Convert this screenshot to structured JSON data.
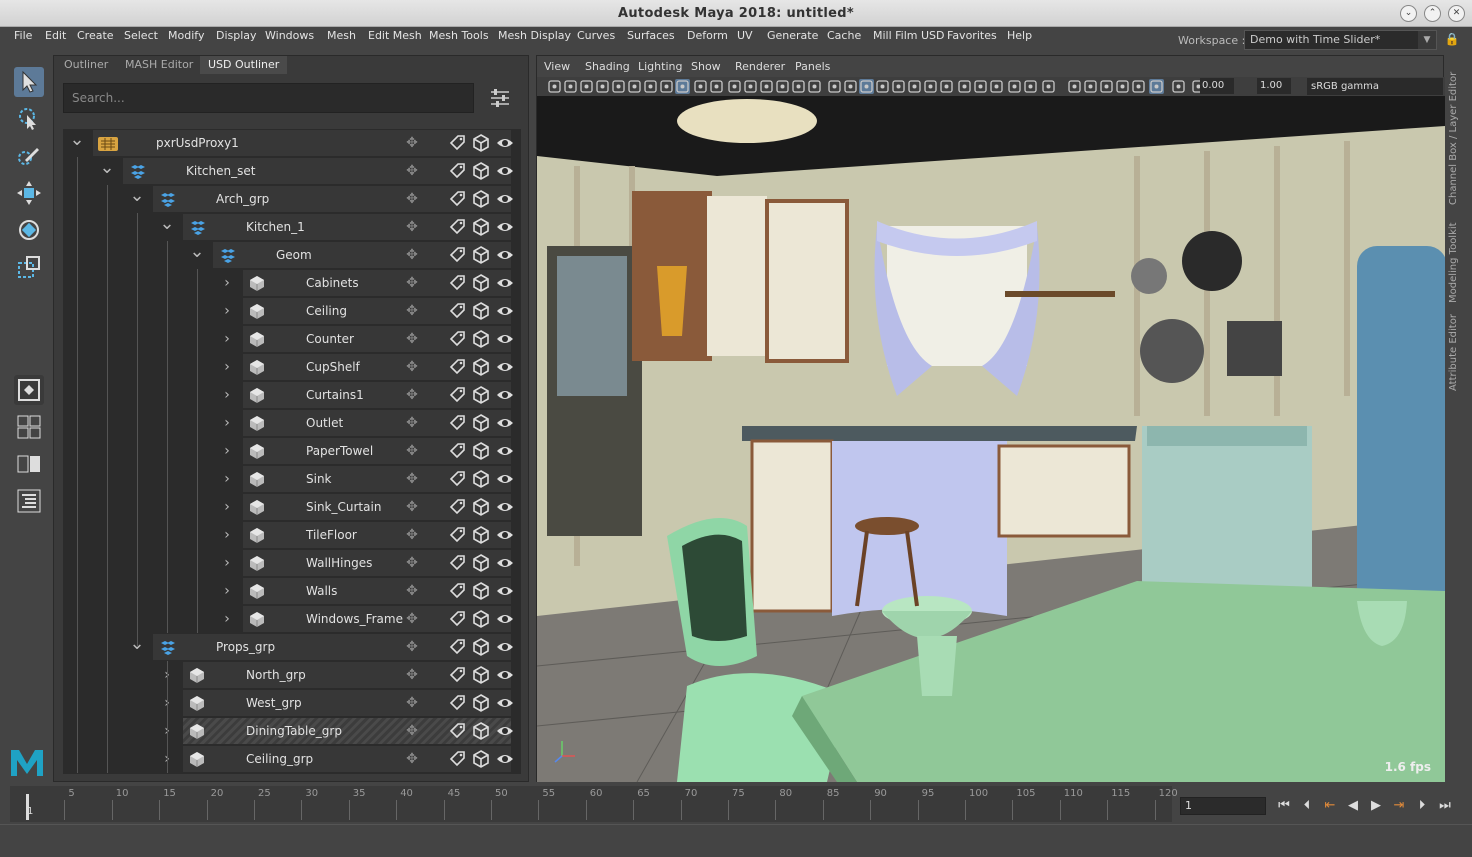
{
  "window": {
    "title": "Autodesk Maya 2018: untitled*"
  },
  "menubar": {
    "items": [
      "File",
      "Edit",
      "Create",
      "Select",
      "Modify",
      "Display",
      "Windows",
      "Mesh",
      "Edit Mesh",
      "Mesh Tools",
      "Mesh Display",
      "Curves",
      "Surfaces",
      "Deform",
      "UV",
      "Generate",
      "Cache",
      "Mill Film USD",
      "Favorites",
      "Help"
    ],
    "workspace_label": "Workspace :",
    "workspace_value": "Demo with Time Slider*"
  },
  "outliner": {
    "tabs": [
      "Outliner",
      "MASH Editor",
      "USD Outliner"
    ],
    "active_tab": "USD Outliner",
    "search_placeholder": "Search...",
    "rows": [
      {
        "label": "pxrUsdProxy1",
        "depth": 0,
        "expanded": true,
        "kind": "proxy"
      },
      {
        "label": "Kitchen_set",
        "depth": 1,
        "expanded": true,
        "kind": "assembly"
      },
      {
        "label": "Arch_grp",
        "depth": 2,
        "expanded": true,
        "kind": "assembly"
      },
      {
        "label": "Kitchen_1",
        "depth": 3,
        "expanded": true,
        "kind": "assembly"
      },
      {
        "label": "Geom",
        "depth": 4,
        "expanded": true,
        "kind": "assembly"
      },
      {
        "label": "Cabinets",
        "depth": 5,
        "expanded": false,
        "kind": "mesh"
      },
      {
        "label": "Ceiling",
        "depth": 5,
        "expanded": false,
        "kind": "mesh"
      },
      {
        "label": "Counter",
        "depth": 5,
        "expanded": false,
        "kind": "mesh"
      },
      {
        "label": "CupShelf",
        "depth": 5,
        "expanded": false,
        "kind": "mesh"
      },
      {
        "label": "Curtains1",
        "depth": 5,
        "expanded": false,
        "kind": "mesh"
      },
      {
        "label": "Outlet",
        "depth": 5,
        "expanded": false,
        "kind": "mesh"
      },
      {
        "label": "PaperTowel",
        "depth": 5,
        "expanded": false,
        "kind": "mesh"
      },
      {
        "label": "Sink",
        "depth": 5,
        "expanded": false,
        "kind": "mesh"
      },
      {
        "label": "Sink_Curtain",
        "depth": 5,
        "expanded": false,
        "kind": "mesh"
      },
      {
        "label": "TileFloor",
        "depth": 5,
        "expanded": false,
        "kind": "mesh"
      },
      {
        "label": "WallHinges",
        "depth": 5,
        "expanded": false,
        "kind": "mesh"
      },
      {
        "label": "Walls",
        "depth": 5,
        "expanded": false,
        "kind": "mesh"
      },
      {
        "label": "Windows_Frame",
        "depth": 5,
        "expanded": false,
        "kind": "mesh"
      },
      {
        "label": "Props_grp",
        "depth": 2,
        "expanded": true,
        "kind": "assembly"
      },
      {
        "label": "North_grp",
        "depth": 3,
        "expanded": false,
        "kind": "mesh"
      },
      {
        "label": "West_grp",
        "depth": 3,
        "expanded": false,
        "kind": "mesh"
      },
      {
        "label": "DiningTable_grp",
        "depth": 3,
        "expanded": false,
        "kind": "mesh",
        "selected": true
      },
      {
        "label": "Ceiling_grp",
        "depth": 3,
        "expanded": false,
        "kind": "mesh"
      }
    ]
  },
  "viewport": {
    "menu": [
      "View",
      "Shading",
      "Lighting",
      "Show",
      "Renderer",
      "Panels"
    ],
    "gamma": "0.00",
    "exposure": "1.00",
    "color_space": "sRGB gamma",
    "fps": "1.6 fps"
  },
  "side_tabs": [
    "Channel Box / Layer Editor",
    "Modeling Toolkit",
    "Attribute Editor"
  ],
  "timeline": {
    "ticks": [
      "5",
      "10",
      "15",
      "20",
      "25",
      "30",
      "35",
      "40",
      "45",
      "50",
      "55",
      "60",
      "65",
      "70",
      "75",
      "80",
      "85",
      "90",
      "95",
      "100",
      "105",
      "110",
      "115",
      "120"
    ],
    "start_label": "1",
    "current_frame": "1"
  },
  "colors": {
    "accent": "#5d7a98",
    "usd_icon": "#4aa3e6",
    "proxy_icon": "#d9a441"
  }
}
